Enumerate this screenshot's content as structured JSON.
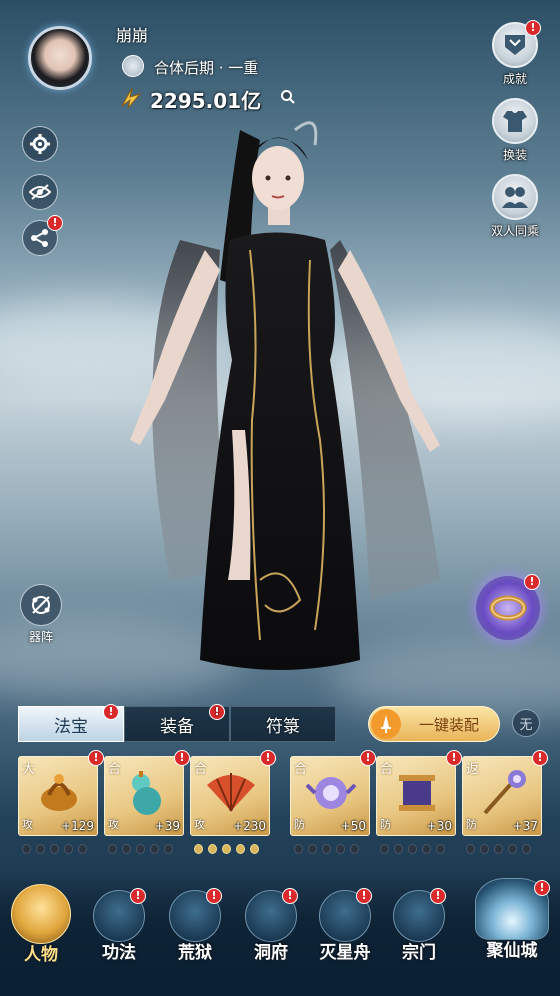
{
  "player": {
    "name": "崩崩",
    "realm": "合体后期 · 一重",
    "power": "2295.01亿"
  },
  "right_menu": [
    {
      "label": "成就",
      "icon": "achievement-icon",
      "alert": "!"
    },
    {
      "label": "换装",
      "icon": "outfit-icon",
      "alert": ""
    },
    {
      "label": "双人同乘",
      "icon": "duo-ride-icon",
      "alert": ""
    }
  ],
  "left_menu": [
    {
      "icon": "gear-icon",
      "alert": ""
    },
    {
      "icon": "eye-hidden-icon",
      "alert": ""
    },
    {
      "icon": "share-icon",
      "alert": "!"
    }
  ],
  "formation": {
    "label": "器阵"
  },
  "alerts": {
    "mark": "!"
  },
  "tabs": [
    {
      "label": "法宝",
      "active": true,
      "alert": "!"
    },
    {
      "label": "装备",
      "active": false,
      "alert": "!"
    },
    {
      "label": "符箓",
      "active": false,
      "alert": ""
    }
  ],
  "one_key_equip": "一键装配",
  "none_button": "无",
  "slots": [
    {
      "grade": "大",
      "type": "攻",
      "level": "+129",
      "icon": "censer-treasure-icon"
    },
    {
      "grade": "合",
      "type": "攻",
      "level": "+39",
      "icon": "gourd-treasure-icon"
    },
    {
      "grade": "合",
      "type": "攻",
      "level": "+230",
      "icon": "fan-treasure-icon"
    },
    {
      "grade": "合",
      "type": "防",
      "level": "+50",
      "icon": "orb-treasure-icon"
    },
    {
      "grade": "合",
      "type": "防",
      "level": "+30",
      "icon": "scroll-treasure-icon"
    },
    {
      "grade": "返",
      "type": "防",
      "level": "+37",
      "icon": "staff-treasure-icon"
    }
  ],
  "bottom_nav": [
    {
      "label": "人物",
      "icon": "character-icon",
      "alert": ""
    },
    {
      "label": "功法",
      "icon": "manual-icon",
      "alert": "!"
    },
    {
      "label": "荒狱",
      "icon": "wasteland-icon",
      "alert": "!"
    },
    {
      "label": "洞府",
      "icon": "cave-icon",
      "alert": "!"
    },
    {
      "label": "灭星舟",
      "icon": "star-ship-icon",
      "alert": "!"
    },
    {
      "label": "宗门",
      "icon": "sect-icon",
      "alert": "!"
    },
    {
      "label": "聚仙城",
      "icon": "immortal-city-icon",
      "alert": "!"
    }
  ],
  "colors": {
    "alert": "#d9292b",
    "gold": "#e8c680",
    "accent": "#f2a93b"
  }
}
